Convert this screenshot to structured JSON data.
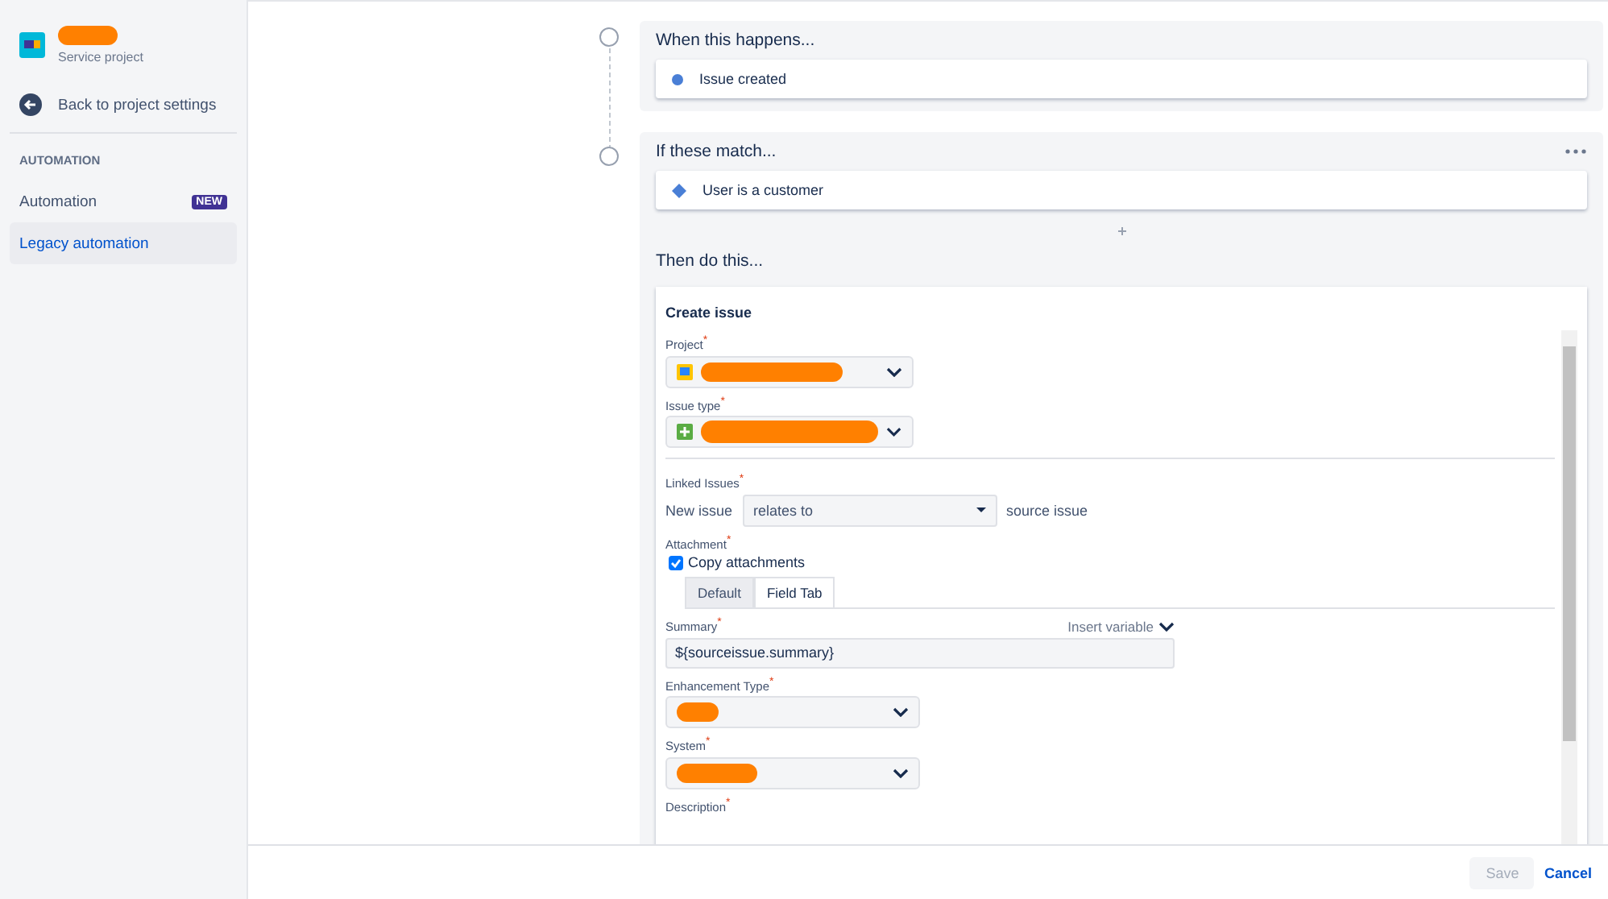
{
  "sidebar": {
    "project_type": "Service project",
    "back_link": "Back to project settings",
    "section": "AUTOMATION",
    "items": [
      {
        "label": "Automation",
        "badge": "NEW",
        "selected": false
      },
      {
        "label": "Legacy automation",
        "selected": true
      }
    ]
  },
  "trigger": {
    "heading": "When this happens...",
    "item": "Issue created"
  },
  "condition": {
    "heading": "If these match...",
    "item": "User is a customer"
  },
  "action": {
    "heading": "Then do this...",
    "title": "Create issue",
    "project": {
      "label": "Project$^{*}$"
    },
    "issue_type": {
      "label": "Issue type$^{*}$"
    },
    "linked_issues": {
      "label": "Linked Issues$^{*}$",
      "prefix": "New issue",
      "value": "relates to",
      "suffix": "source issue"
    },
    "attachment": {
      "label": "Attachment$^{*}$",
      "checkbox": {
        "label": "Copy attachments",
        "checked": true
      }
    },
    "tabs": [
      {
        "label": "Default",
        "selected": false
      },
      {
        "label": "Field Tab",
        "selected": true
      }
    ],
    "summary": {
      "label": "Summary$^{*}$",
      "insert_variable": "Insert variable",
      "value": "${sourceissue.summary}"
    },
    "enhancement_type": {
      "label": "Enhancement Type$^{*}$"
    },
    "system": {
      "label": "System$^{*}$"
    },
    "description": {
      "label": "Description$^{*}$"
    }
  },
  "footer": {
    "save": {
      "label": "Save",
      "disabled": true
    },
    "cancel": "Cancel"
  }
}
